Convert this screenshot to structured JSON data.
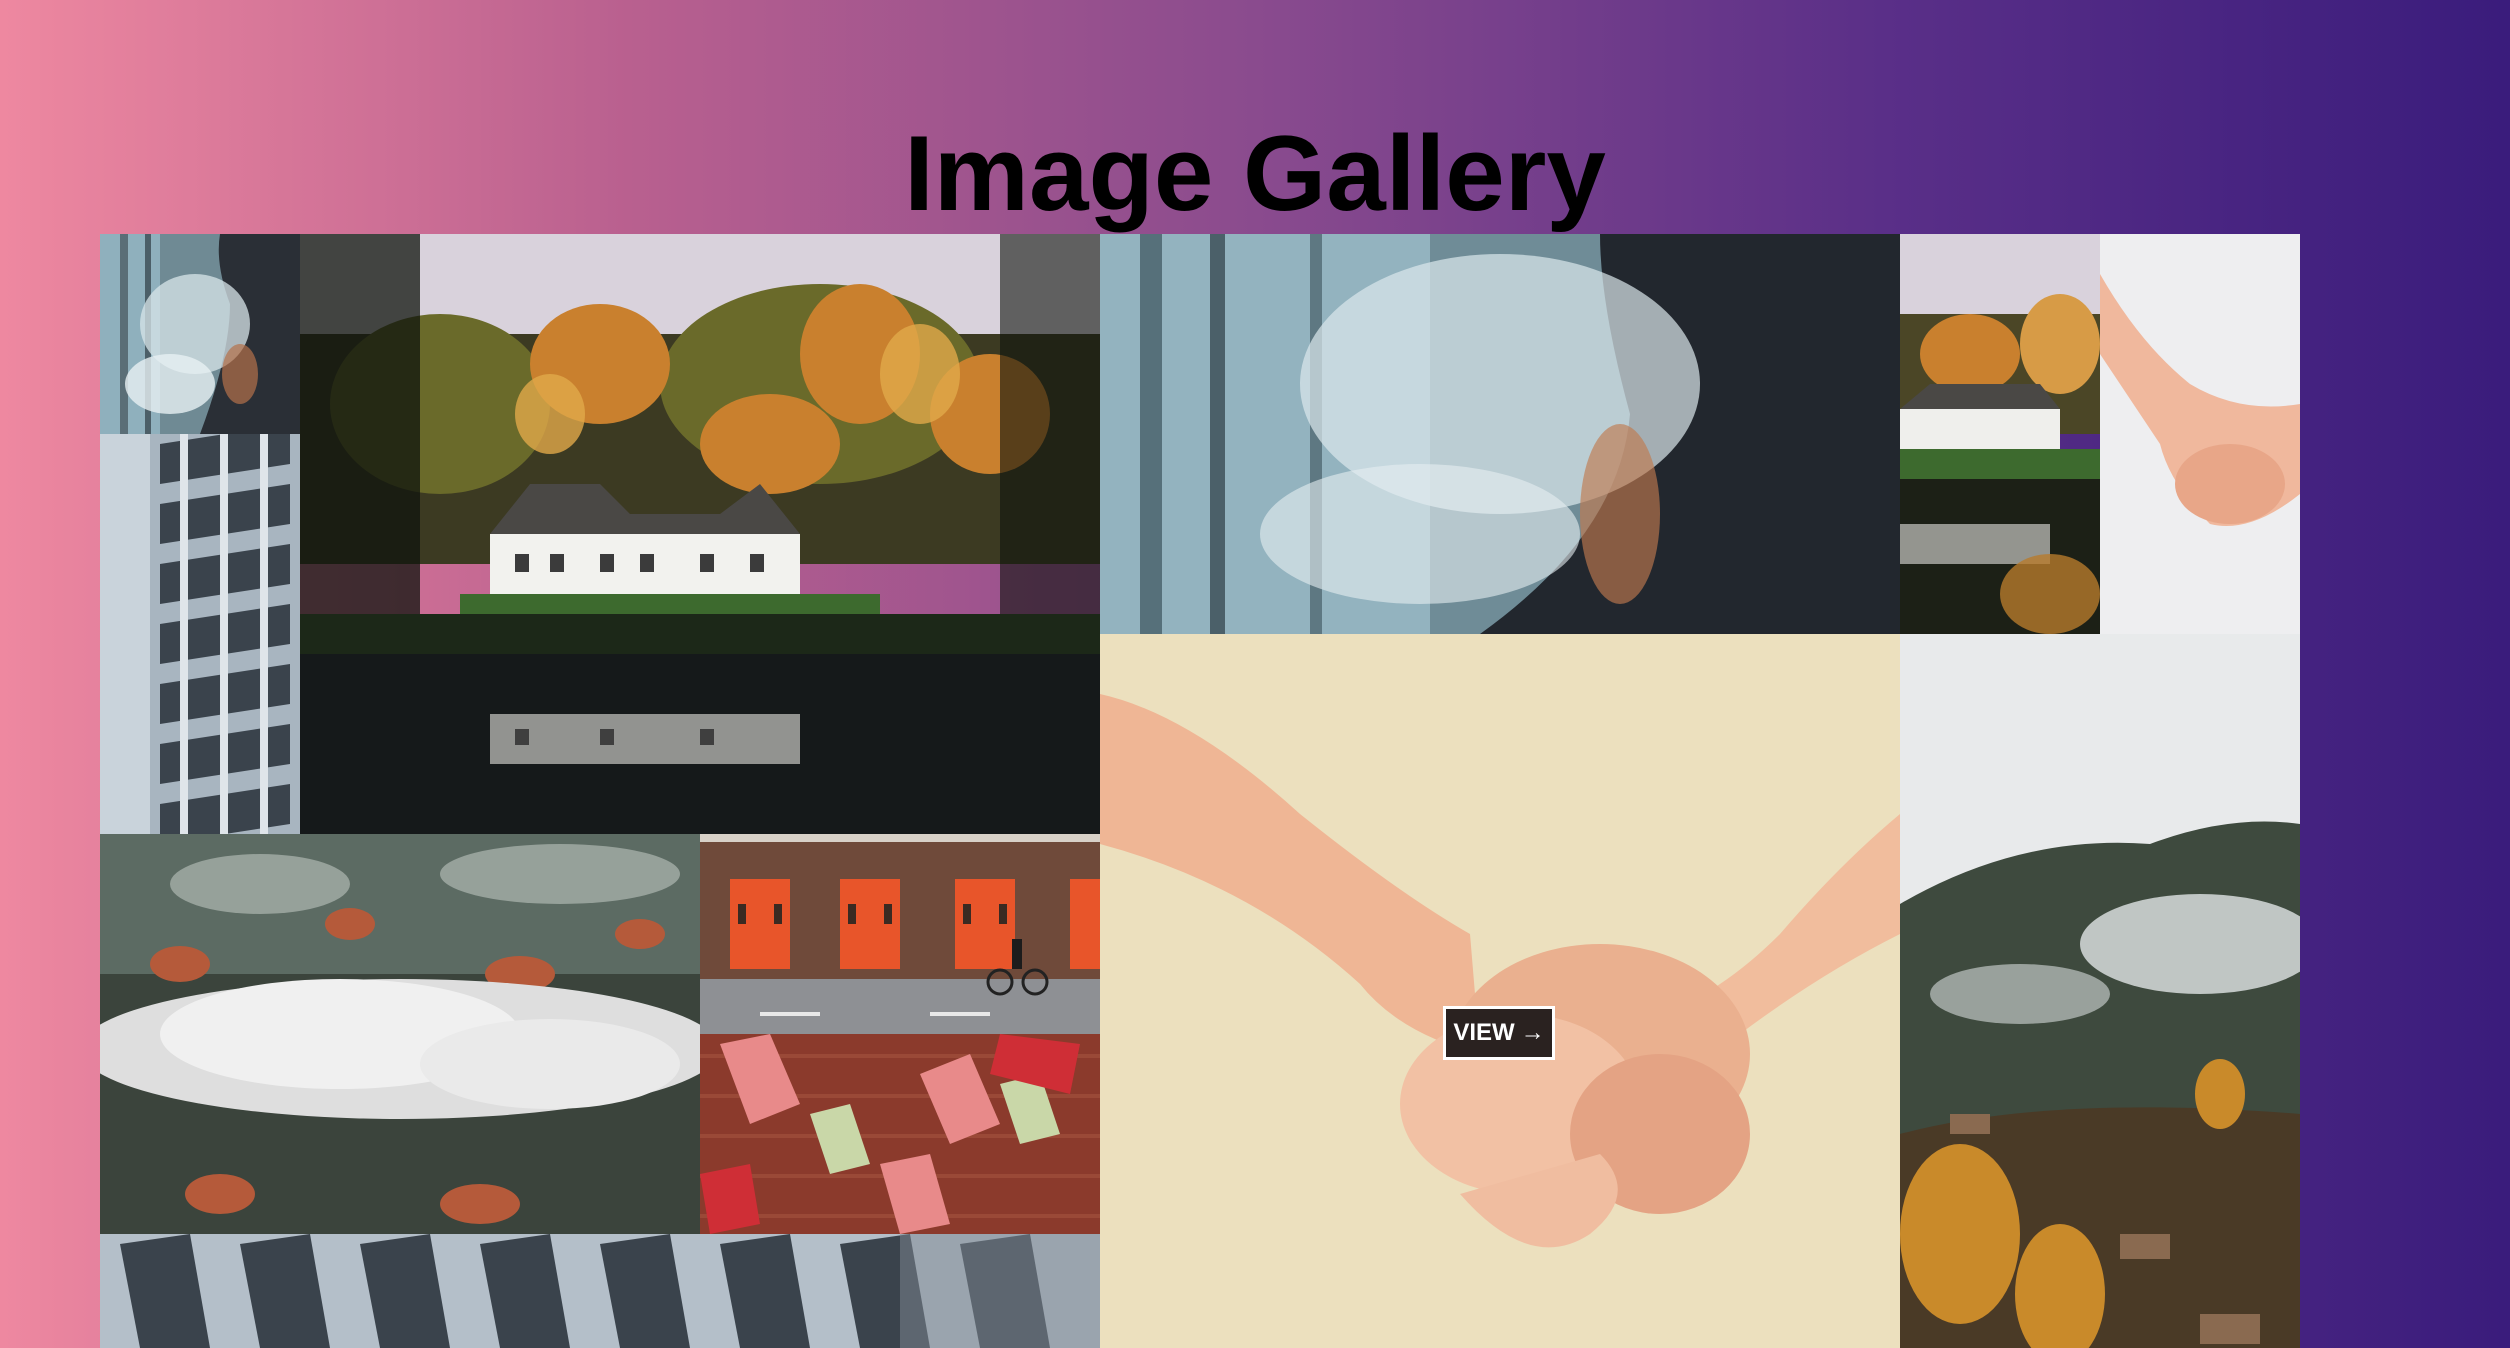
{
  "page": {
    "title": "Image Gallery"
  },
  "gallery": {
    "tiles": [
      {
        "subject": "person with smoke (small)"
      },
      {
        "subject": "white house by lake in autumn forest"
      },
      {
        "subject": "person with smoke (large)"
      },
      {
        "subject": "white house by lake (small)"
      },
      {
        "subject": "holding hands (small)"
      },
      {
        "subject": "building facade"
      },
      {
        "subject": "holding hands (large)"
      },
      {
        "subject": "misty forested mountain village"
      },
      {
        "subject": "forest with low cloud"
      },
      {
        "subject": "fire station with cyclist"
      },
      {
        "subject": "red window shutters"
      },
      {
        "subject": "building facade (wide)"
      }
    ],
    "view_button": {
      "label": "VIEW",
      "icon": "arrow-right-icon"
    }
  },
  "colors": {
    "gradient_left": "#ee88a0",
    "gradient_right": "#3a1c7c",
    "button_bg": "#2a2220",
    "button_border": "#ffffff"
  }
}
